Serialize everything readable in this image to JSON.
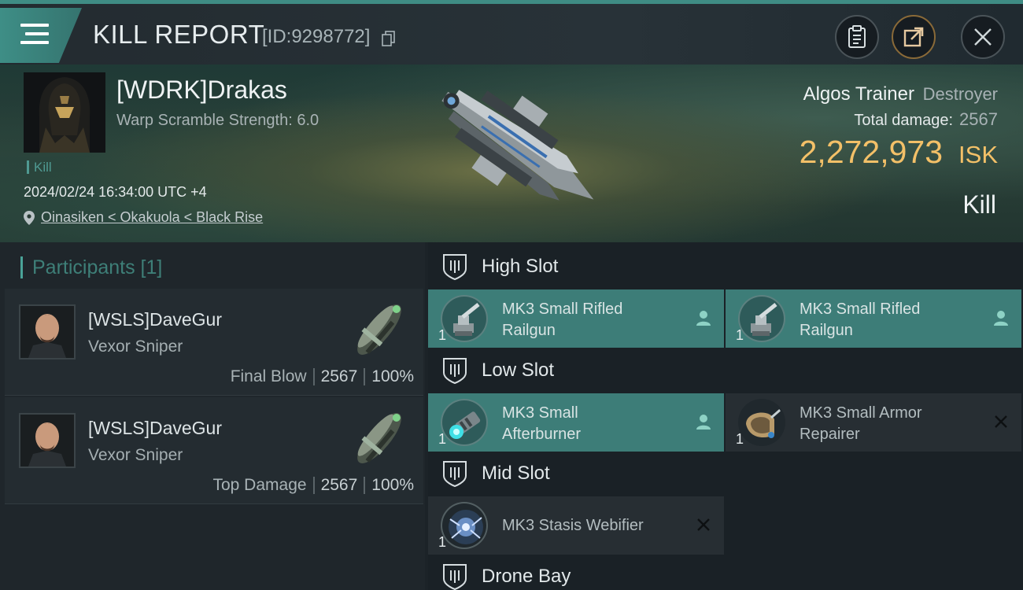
{
  "header": {
    "title": "KILL REPORT",
    "report_id": "[ID:9298772]"
  },
  "victim": {
    "name": "[WDRK]Drakas",
    "warp_scramble": "Warp Scramble Strength: 6.0",
    "kill_tag": "Kill",
    "datetime": "2024/02/24 16:34:00 UTC +4",
    "location": "Oinasiken < Okakuola < Black Rise",
    "ship_name": "Algos Trainer",
    "ship_class": "Destroyer",
    "total_damage_label": "Total damage:",
    "total_damage": "2567",
    "isk_value": "2,272,973",
    "isk_unit": "ISK",
    "result": "Kill"
  },
  "participants": {
    "heading": "Participants [1]",
    "cards": [
      {
        "name": "[WSLS]DaveGur",
        "ship": "Vexor Sniper",
        "role": "Final Blow",
        "damage": "2567",
        "percent": "100%"
      },
      {
        "name": "[WSLS]DaveGur",
        "ship": "Vexor Sniper",
        "role": "Top Damage",
        "damage": "2567",
        "percent": "100%"
      }
    ]
  },
  "slots": {
    "high": {
      "title": "High Slot",
      "modules": [
        {
          "name_line1": "MK3 Small Rifled",
          "name_line2": "Railgun",
          "qty": "1",
          "status": "fitted"
        },
        {
          "name_line1": "MK3 Small Rifled",
          "name_line2": "Railgun",
          "qty": "1",
          "status": "fitted"
        }
      ]
    },
    "low": {
      "title": "Low Slot",
      "modules": [
        {
          "name_line1": "MK3 Small",
          "name_line2": "Afterburner",
          "qty": "1",
          "status": "fitted"
        },
        {
          "name_line1": "MK3 Small Armor",
          "name_line2": "Repairer",
          "qty": "1",
          "status": "destroyed"
        }
      ]
    },
    "mid": {
      "title": "Mid Slot",
      "modules": [
        {
          "name_line1": "MK3 Stasis Webifier",
          "name_line2": "",
          "qty": "1",
          "status": "destroyed"
        }
      ]
    },
    "drone": {
      "title": "Drone Bay"
    }
  },
  "colors": {
    "accent_teal": "#3d7d78",
    "isk_gold": "#f3c068",
    "panel_dark": "#1f262b"
  },
  "icons": {
    "menu": "hamburger-icon",
    "copy": "copy-icon",
    "clipboard": "clipboard-icon",
    "share": "share-icon",
    "close": "close-icon",
    "location": "location-pin-icon",
    "slot": "shield-slot-icon",
    "fitted": "pilot-icon",
    "destroyed": "x-icon"
  }
}
